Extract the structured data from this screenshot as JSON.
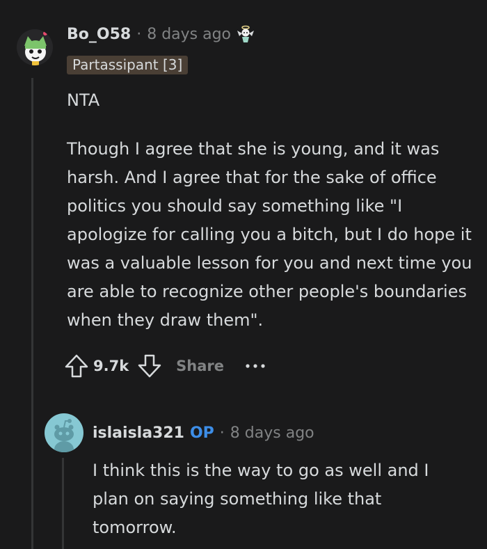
{
  "comment": {
    "username": "Bo_O58",
    "separator": "·",
    "time": "8 days ago",
    "award_icon": "angel-award-icon",
    "flair": "Partassipant [3]",
    "paragraphs": [
      "NTA",
      "Though I agree that she is young, and it was harsh. And I agree that for the sake of office politics you should say something like \"I apologize for calling you a bitch, but I do hope it was a valuable lesson for you and next time you are able to recognize other people's boundaries when they draw them\"."
    ],
    "score": "9.7k",
    "share_label": "Share"
  },
  "reply": {
    "username": "islaisla321",
    "op_label": "OP",
    "separator": "·",
    "time": "8 days ago",
    "text": "I think this is the way to go as well and I plan on saying something like that tomorrow."
  },
  "colors": {
    "background": "#1a1a1b",
    "text": "#d7dadc",
    "muted": "#818384",
    "op": "#3d8ee8",
    "flair_bg": "#4a3f35",
    "thread_line": "#343536"
  }
}
